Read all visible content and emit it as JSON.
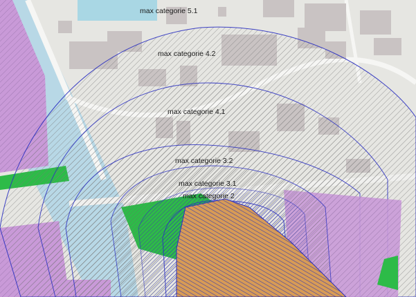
{
  "map": {
    "zone_labels": {
      "cat_5_1": "max categorie 5.1",
      "cat_4_2": "max categorie 4.2",
      "cat_4_1": "max categorie 4.1",
      "cat_3_2": "max categorie 3.2",
      "cat_3_1": "max categorie 3.1",
      "cat_2": "max categorie 2"
    },
    "colors": {
      "base_land": "#e6e6e2",
      "building": "#c9c3c3",
      "road": "#f4f4f2",
      "water": "#b8d8e6",
      "industrial": "#c99ad8",
      "green": "#2dbb48",
      "site_orange": "#d89b55",
      "site_hatch": "#3a3fae",
      "zone_outline": "#2a2fc0",
      "hatch_line": "#8a8a8a"
    }
  }
}
